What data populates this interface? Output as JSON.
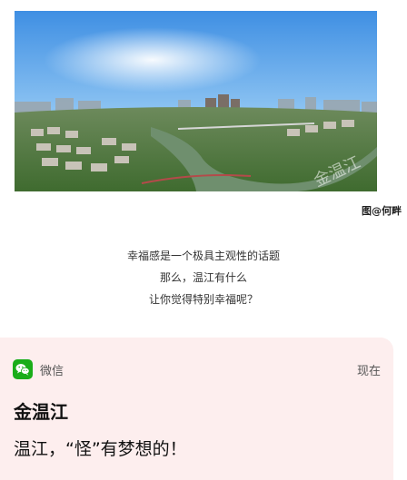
{
  "photo": {
    "credit": "图@何畔",
    "watermark": "金温江",
    "icon": "aerial-city-panorama"
  },
  "caption": {
    "lines": [
      "幸福感是一个极具主观性的话题",
      "那么，温江有什么",
      "让你觉得特别幸福呢？"
    ]
  },
  "notification": {
    "app_icon": "wechat-icon",
    "app_name": "微信",
    "time": "现在",
    "sender": "金温江",
    "message": "温江，“怪”有梦想的！",
    "colors": {
      "background": "#fdeeee",
      "wechat_green": "#1aad19"
    }
  }
}
